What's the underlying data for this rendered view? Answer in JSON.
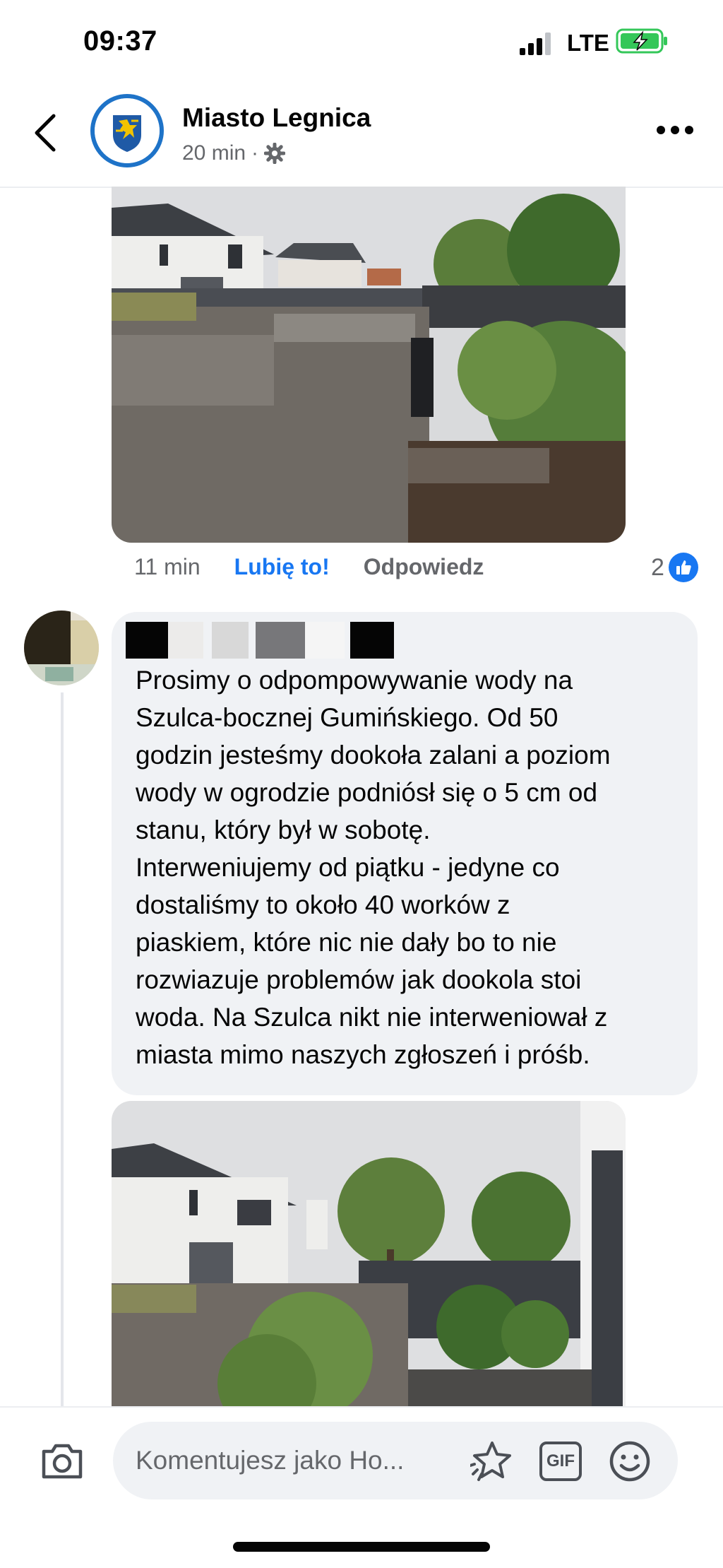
{
  "status_bar": {
    "time": "09:37",
    "network": "LTE",
    "battery_icon": "battery-charging-icon"
  },
  "header": {
    "page_name": "Miasto Legnica",
    "timestamp": "20 min",
    "separator": "·",
    "audience_icon": "gear-icon",
    "back_icon": "chevron-left-icon",
    "more_icon": "more-horizontal-icon"
  },
  "reply_actions": {
    "time": "11 min",
    "like_label": "Lubię to!",
    "reply_label": "Odpowiedz",
    "reaction_count": "2",
    "reaction_icon": "thumbs-up-icon"
  },
  "comment": {
    "author": "",
    "text": "Prosimy o odpompowywanie wody na\nSzulca-bocznej Gumińskiego. Od 50\ngodzin jesteśmy dookoła zalani a poziom\nwody w ogrodzie podniósł się o 5 cm od\nstanu, który był w sobotę.\nInterweniujemy od piątku - jedyne co\ndostaliśmy to około 40 worków z\npiaskiem, które nic nie dały bo to nie\nrozwiazuje problemów jak dookola stoi\nwoda. Na Szulca nikt nie interweniował z\nmiasta mimo naszych zgłoszeń i próśb."
  },
  "composer": {
    "placeholder": "Komentujesz jako Ho...",
    "gif_label": "GIF",
    "icons": [
      "camera-icon",
      "sticker-icon",
      "gif-icon",
      "emoji-icon"
    ]
  },
  "colors": {
    "accent": "#1877f2",
    "bubble": "#f0f2f5",
    "muted": "#65676b",
    "battery": "#34c759"
  }
}
